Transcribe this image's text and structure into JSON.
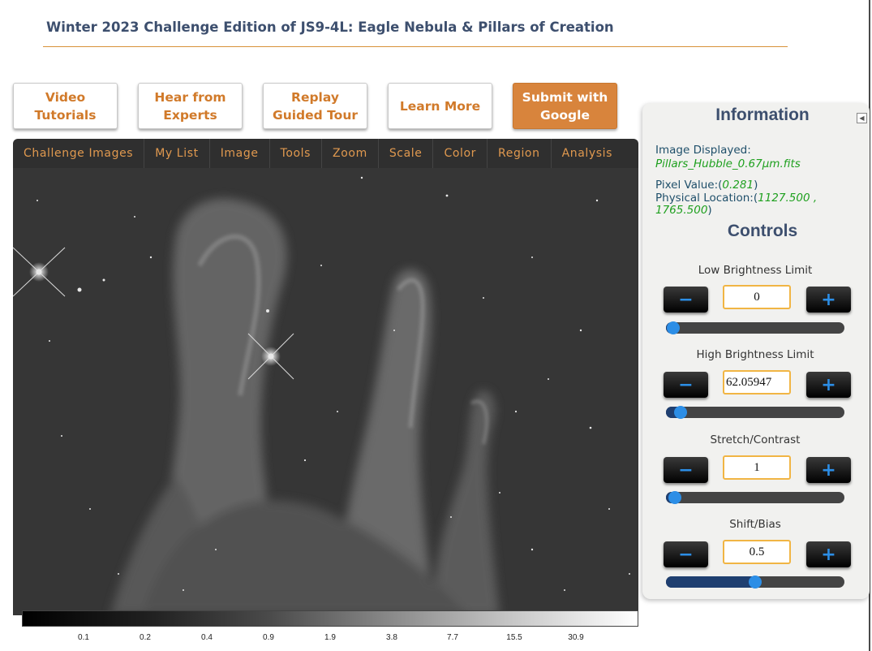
{
  "title": "Winter 2023 Challenge Edition of JS9-4L: Eagle Nebula & Pillars of Creation",
  "nav_buttons": [
    {
      "label": "Video\nTutorials"
    },
    {
      "label": "Hear from\nExperts"
    },
    {
      "label": "Replay\nGuided Tour"
    },
    {
      "label": "Learn More"
    },
    {
      "label": "Submit with\nGoogle"
    }
  ],
  "menu": [
    "Challenge Images",
    "My List",
    "Image",
    "Tools",
    "Zoom",
    "Scale",
    "Color",
    "Region",
    "Analysis"
  ],
  "colorbar": {
    "ticks": [
      "0.1",
      "0.2",
      "0.4",
      "0.9",
      "1.9",
      "3.8",
      "7.7",
      "15.5",
      "30.9"
    ]
  },
  "info": {
    "heading": "Information",
    "image_label": "Image Displayed:",
    "image_value": "Pillars_Hubble_0.67μm.fits",
    "pixel_label": "Pixel Value:(",
    "pixel_value": "0.281",
    "pixel_close": ")",
    "physical_label": "Physical Location:(",
    "physical_value_1": "1127.500 ,",
    "physical_value_2": "1765.500",
    "physical_close": ")"
  },
  "controls": {
    "heading": "Controls",
    "minus": "−",
    "plus": "+",
    "items": [
      {
        "label": "Low Brightness Limit",
        "value": "0",
        "level": 0.04
      },
      {
        "label": "High Brightness Limit",
        "value": "62.05947",
        "level": 0.08
      },
      {
        "label": "Stretch/Contrast",
        "value": "1",
        "level": 0.05
      },
      {
        "label": "Shift/Bias",
        "value": "0.5",
        "level": 0.5
      }
    ]
  },
  "colors": {
    "accent": "#d8843c",
    "title": "#3d4f6e",
    "slider_thumb": "#2c8ee6",
    "info_value": "#1fa01f"
  }
}
